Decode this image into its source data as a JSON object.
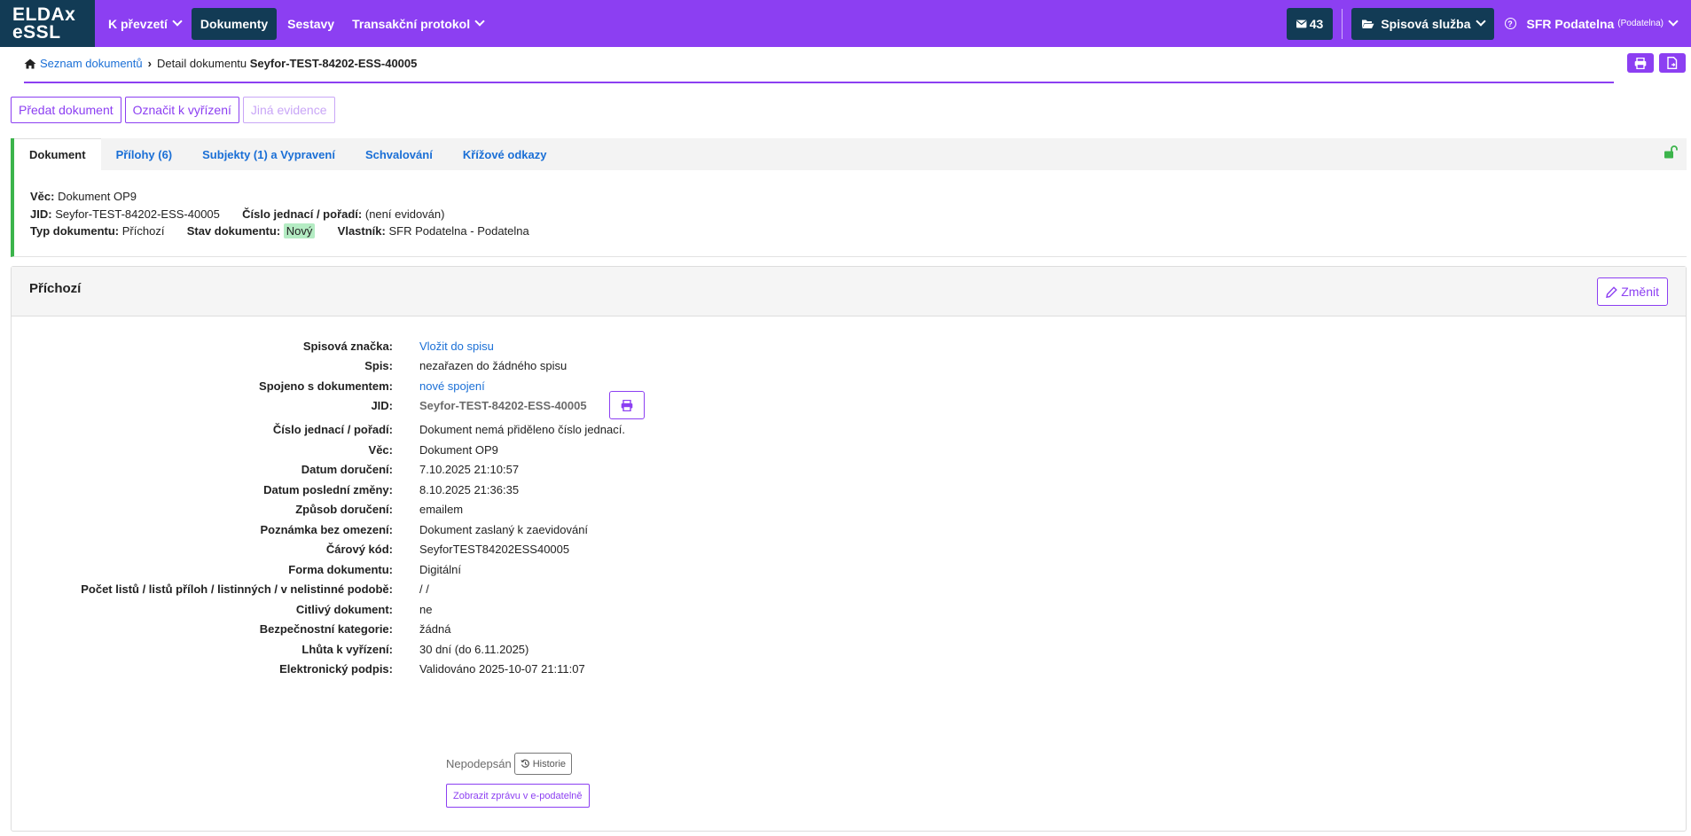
{
  "app": {
    "logo_line1": "ELDAx",
    "logo_line2": "eSSL"
  },
  "nav": {
    "items": [
      {
        "label": "K převzetí",
        "has_dropdown": true,
        "active": false
      },
      {
        "label": "Dokumenty",
        "has_dropdown": false,
        "active": true
      },
      {
        "label": "Sestavy",
        "has_dropdown": false,
        "active": false
      },
      {
        "label": "Transakční protokol",
        "has_dropdown": true,
        "active": false
      }
    ],
    "mail_count": "43",
    "spisova_sluzba": "Spisová služba",
    "user_name": "SFR Podatelna",
    "user_role": "(Podatelna)"
  },
  "breadcrumb": {
    "home_link": "Seznam dokumentů",
    "current_prefix": "Detail dokumentu",
    "current_id": "Seyfor-TEST-84202-ESS-40005"
  },
  "actions": {
    "predat": "Předat dokument",
    "oznacit": "Označit k vyřízení",
    "jina": "Jiná evidence"
  },
  "tabs": [
    {
      "label": "Dokument",
      "active": true
    },
    {
      "label": "Přílohy (6)",
      "active": false
    },
    {
      "label": "Subjekty (1) a Vypravení",
      "active": false
    },
    {
      "label": "Schvalování",
      "active": false
    },
    {
      "label": "Křížové odkazy",
      "active": false
    }
  ],
  "summary": {
    "vec_label": "Věc:",
    "vec": "Dokument OP9",
    "jid_label": "JID:",
    "jid": "Seyfor-TEST-84202-ESS-40005",
    "cj_label": "Číslo jednací / pořadí:",
    "cj": "(není evidován)",
    "typ_label": "Typ dokumentu:",
    "typ": "Příchozí",
    "stav_label": "Stav dokumentu:",
    "stav": "Nový",
    "vlastnik_label": "Vlastník:",
    "vlastnik": "SFR Podatelna - Podatelna"
  },
  "detail": {
    "title": "Příchozí",
    "change_label": "Změnit",
    "rows": [
      {
        "label": "Spisová značka:",
        "value": "Vložit do spisu",
        "kind": "link"
      },
      {
        "label": "Spis:",
        "value": "nezařazen do žádného spisu",
        "kind": "text"
      },
      {
        "label": "Spojeno s dokumentem:",
        "value": "nové spojení",
        "kind": "link"
      },
      {
        "label": "JID:",
        "value": "Seyfor-TEST-84202-ESS-40005",
        "kind": "jid"
      },
      {
        "label": "Číslo jednací / pořadí:",
        "value": "Dokument nemá přiděleno číslo jednací.",
        "kind": "text"
      },
      {
        "label": "Věc:",
        "value": "Dokument OP9",
        "kind": "text"
      },
      {
        "label": "Datum doručení:",
        "value": "7.10.2025 21:10:57",
        "kind": "text"
      },
      {
        "label": "Datum poslední změny:",
        "value": "8.10.2025 21:36:35",
        "kind": "text"
      },
      {
        "label": "Způsob doručení:",
        "value": "emailem",
        "kind": "text"
      },
      {
        "label": "Poznámka bez omezení:",
        "value": "Dokument zaslaný k zaevidování",
        "kind": "text"
      },
      {
        "label": "Čárový kód:",
        "value": "SeyforTEST84202ESS40005",
        "kind": "text"
      },
      {
        "label": "Forma dokumentu:",
        "value": "Digitální",
        "kind": "text"
      },
      {
        "label": "Počet listů / listů příloh / listinných / v nelistinné podobě:",
        "value": "/ /",
        "kind": "text"
      },
      {
        "label": "Citlivý dokument:",
        "value": "ne",
        "kind": "text"
      },
      {
        "label": "Bezpečnostní kategorie:",
        "value": "žádná",
        "kind": "text"
      },
      {
        "label": "Lhůta k vyřízení:",
        "value": "30 dní (do 6.11.2025)",
        "kind": "text"
      },
      {
        "label": "Elektronický podpis:",
        "value": "Validováno 2025-10-07 21:11:07",
        "kind": "text"
      }
    ],
    "signature_status": "Nepodepsán",
    "history_label": "Historie",
    "epodatelna_label": "Zobrazit zprávu v e-podatelně"
  },
  "colors": {
    "brand": "#8c3ff2",
    "dark": "#123b55",
    "link": "#1a6fd6",
    "status_green": "#3cb44b"
  }
}
